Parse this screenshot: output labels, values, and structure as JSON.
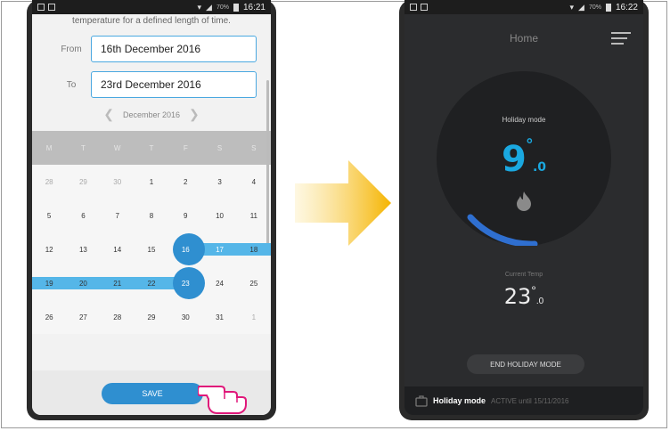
{
  "left_phone": {
    "status_time": "16:21",
    "status_battery": "70%",
    "description": "temperature for a defined length of time.",
    "from_label": "From",
    "from_value": "16th December 2016",
    "to_label": "To",
    "to_value": "23rd December 2016",
    "month_label": "December 2016",
    "weekdays": [
      "M",
      "T",
      "W",
      "T",
      "F",
      "S",
      "S"
    ],
    "weeks": [
      [
        "28",
        "29",
        "30",
        "1",
        "2",
        "3",
        "4"
      ],
      [
        "5",
        "6",
        "7",
        "8",
        "9",
        "10",
        "11"
      ],
      [
        "12",
        "13",
        "14",
        "15",
        "16",
        "17",
        "18"
      ],
      [
        "19",
        "20",
        "21",
        "22",
        "23",
        "24",
        "25"
      ],
      [
        "26",
        "27",
        "28",
        "29",
        "30",
        "31",
        "1"
      ]
    ],
    "save_label": "SAVE"
  },
  "right_phone": {
    "status_time": "16:22",
    "status_battery": "70%",
    "title": "Home",
    "mode_label": "Holiday mode",
    "set_temp_int": "9",
    "set_temp_dec": ".0",
    "degree": "°",
    "current_label": "Current Temp",
    "current_temp_int": "23",
    "current_temp_dec": ".0",
    "end_button_label": "END HOLIDAY MODE",
    "footer_mode": "Holiday mode",
    "footer_status": "ACTIVE until 15/11/2016"
  },
  "colors": {
    "accent_blue": "#2f8fd0",
    "band_blue": "#55b6e8",
    "temp_blue": "#1aa8e0",
    "arrow_yellow": "#f5b400"
  }
}
